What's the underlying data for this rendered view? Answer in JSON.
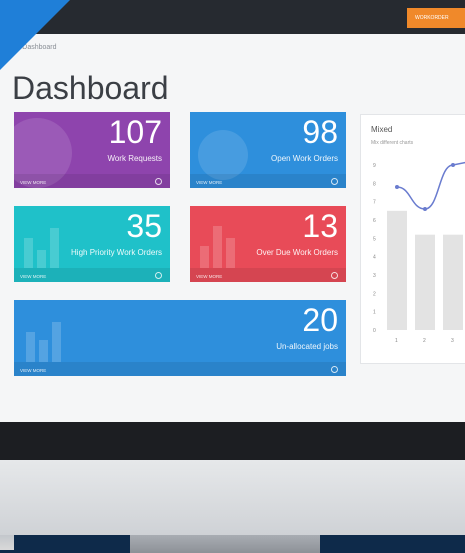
{
  "topbar": {
    "button_label": "WORKORDER"
  },
  "breadcrumb": "Dashboard",
  "page_title": "Dashboard",
  "tiles": [
    {
      "value": "107",
      "label": "Work Requests",
      "footer": "VIEW MORE",
      "color": "#8e44ad"
    },
    {
      "value": "98",
      "label": "Open Work Orders",
      "footer": "VIEW MORE",
      "color": "#2e8fdc"
    },
    {
      "value": "35",
      "label": "High Priority Work Orders",
      "footer": "VIEW MORE",
      "color": "#1fc1c9"
    },
    {
      "value": "13",
      "label": "Over Due Work Orders",
      "footer": "VIEW MORE",
      "color": "#e84b58"
    },
    {
      "value": "20",
      "label": "Un-allocated jobs",
      "footer": "VIEW MORE",
      "color": "#2e8fdc"
    }
  ],
  "mixed_panel": {
    "title": "Mixed",
    "subtitle": "Mix different charts"
  },
  "chart_data": {
    "type": "bar",
    "title": "",
    "categories": [
      "1",
      "2",
      "3"
    ],
    "y_ticks": [
      "0",
      "1",
      "2",
      "3",
      "4",
      "5",
      "6",
      "7",
      "8",
      "9"
    ],
    "ylim": [
      0,
      9
    ],
    "series": [
      {
        "type": "bar",
        "values": [
          6.5,
          5.2,
          5.2
        ]
      },
      {
        "type": "line",
        "values": [
          7.8,
          6.6,
          9.0
        ]
      }
    ],
    "colors": {
      "bar": "#e3e3e3",
      "line": "#6a7ccf"
    }
  }
}
